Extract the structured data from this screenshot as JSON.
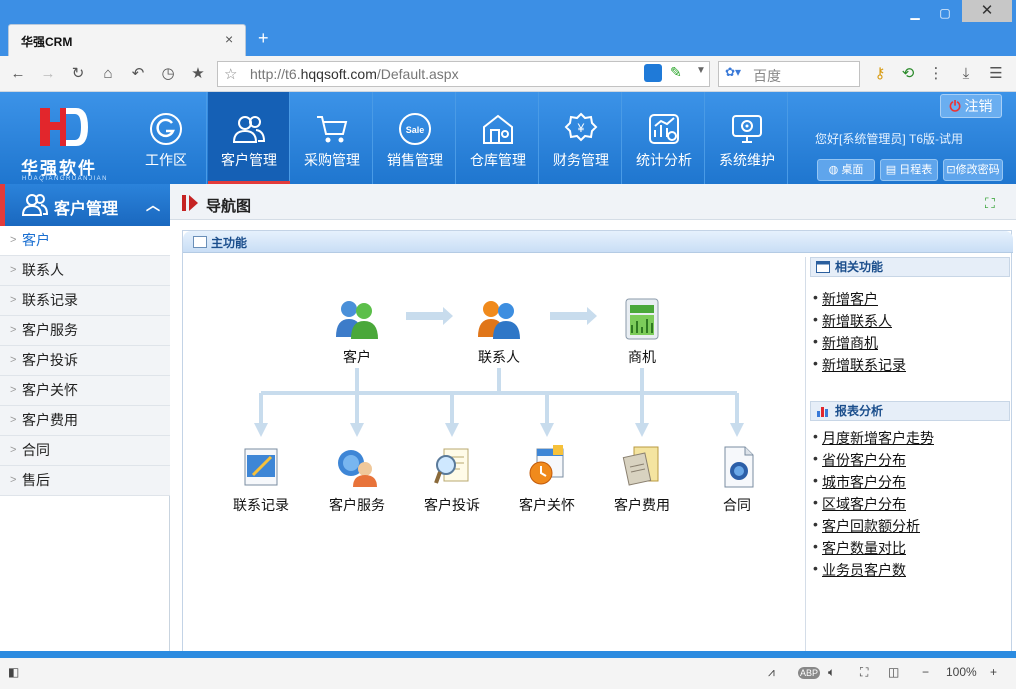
{
  "browser": {
    "tab_title": "华强CRM",
    "tab_close": "×",
    "new_tab": "+",
    "url_scheme": "http://t6.",
    "url_domain": "hqqsoft.com",
    "url_path": "/Default.aspx",
    "search_placeholder": "百度",
    "zoom": "100%"
  },
  "header": {
    "logo_text": "华强软件",
    "logo_sub": "HUAQIANGRUANJIAN",
    "logout_label": "注销",
    "greeting": "您好[系统管理员] T6版-试用",
    "buttons": [
      "桌面",
      "日程表",
      "修改密码"
    ]
  },
  "nav": {
    "items": [
      {
        "label": "工作区",
        "icon": "workspace-icon"
      },
      {
        "label": "客户管理",
        "icon": "customers-icon"
      },
      {
        "label": "采购管理",
        "icon": "cart-icon"
      },
      {
        "label": "销售管理",
        "icon": "sale-icon"
      },
      {
        "label": "仓库管理",
        "icon": "warehouse-icon"
      },
      {
        "label": "财务管理",
        "icon": "finance-icon"
      },
      {
        "label": "统计分析",
        "icon": "stats-icon"
      },
      {
        "label": "系统维护",
        "icon": "maintenance-icon"
      }
    ],
    "active_index": 1
  },
  "sidebar": {
    "title": "客户管理",
    "items": [
      "客户",
      "联系人",
      "联系记录",
      "客户服务",
      "客户投诉",
      "客户关怀",
      "客户费用",
      "合同",
      "售后"
    ],
    "active_index": 0
  },
  "main": {
    "page_title": "导航图",
    "panel_title": "主功能",
    "flow_top": [
      "客户",
      "联系人",
      "商机"
    ],
    "flow_bottom": [
      "联系记录",
      "客户服务",
      "客户投诉",
      "客户关怀",
      "客户费用",
      "合同"
    ]
  },
  "related": {
    "title": "相关功能",
    "links": [
      "新增客户",
      "新增联系人",
      "新增商机",
      "新增联系记录"
    ]
  },
  "reports": {
    "title": "报表分析",
    "links": [
      "月度新增客户走势",
      "省份客户分布",
      "城市客户分布",
      "区域客户分布",
      "客户回款额分析",
      "客户数量对比",
      "业务员客户数"
    ]
  },
  "colors": {
    "header_blue": "#1f76cf",
    "active_red": "#e23b3b",
    "link_blue": "#1a6fd1"
  }
}
